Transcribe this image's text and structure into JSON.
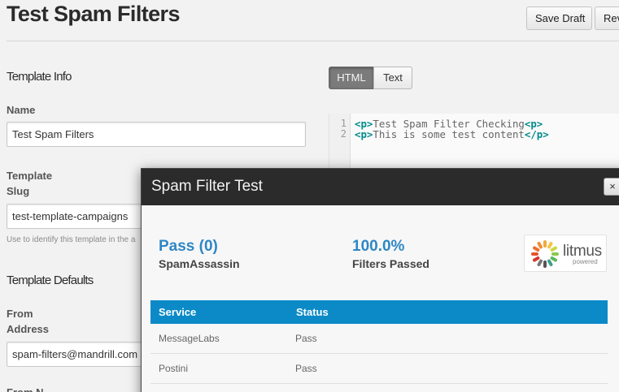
{
  "header": {
    "title": "Test Spam Filters",
    "save_draft_label": "Save Draft",
    "review_label": "Rev"
  },
  "template_info": {
    "section_title": "Template Info",
    "name_label": "Name",
    "name_value": "Test Spam Filters",
    "slug_label_line1": "Template",
    "slug_label_line2": "Slug",
    "slug_value": "test-template-campaigns",
    "slug_help": "Use to identify this template in the a"
  },
  "template_defaults": {
    "section_title": "Template Defaults",
    "from_address_label_line1": "From",
    "from_address_label_line2": "Address",
    "from_address_value": "spam-filters@mandrill.com",
    "from_name_label_partial": "From N"
  },
  "editor": {
    "tab_html": "HTML",
    "tab_text": "Text",
    "active_tab": "HTML",
    "lines": [
      {
        "number": "1",
        "open_tag": "<p>",
        "text": "Test Spam Filter Checking",
        "close_tag": "<p>"
      },
      {
        "number": "2",
        "open_tag": "<p>",
        "text": "This is some test content",
        "close_tag": "</p>"
      }
    ]
  },
  "modal": {
    "title": "Spam Filter Test",
    "close_symbol": "×",
    "spamassassin_result": "Pass (0)",
    "spamassassin_label": "SpamAssassin",
    "filters_percent": "100.0%",
    "filters_label": "Filters Passed",
    "logo_word": "litmus",
    "logo_sub": "powered",
    "table": {
      "columns": [
        "Service",
        "Status"
      ],
      "rows": [
        {
          "service": "MessageLabs",
          "status": "Pass"
        },
        {
          "service": "Postini",
          "status": "Pass"
        }
      ]
    }
  },
  "colors": {
    "accent_blue": "#2e87c5",
    "table_header_blue": "#0b8ac7",
    "modal_header": "#2b2b2b"
  }
}
